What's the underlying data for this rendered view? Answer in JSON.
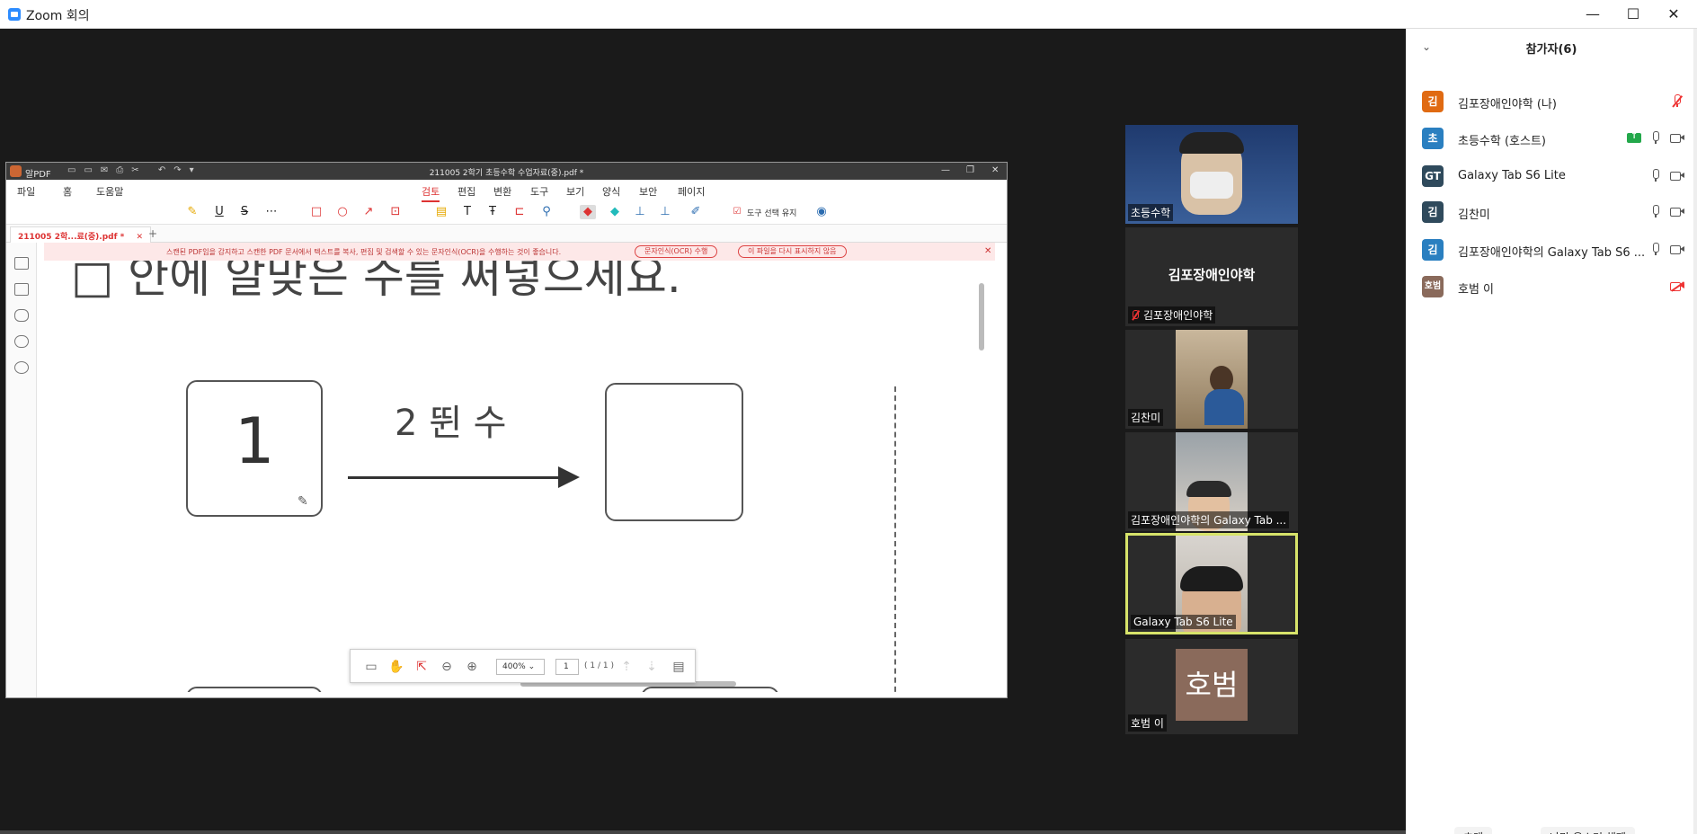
{
  "window": {
    "title": "Zoom 회의",
    "minimize": "—",
    "maximize": "☐",
    "close": "✕"
  },
  "pdf": {
    "app_name": "알PDF",
    "doc_title": "211005 2학기 초등수학 수업자료(중).pdf *",
    "menu": [
      "파일",
      "홈",
      "도움말"
    ],
    "ribbon_tabs": [
      "검토",
      "편집",
      "변환",
      "도구",
      "보기",
      "양식",
      "보안",
      "페이지"
    ],
    "active_tab": "검토",
    "keep_tool_label": "도구 선택 유지",
    "tab_label": "211005 2학...료(중).pdf *",
    "tab_close": "✕",
    "tab_add": "+",
    "ocr_message": "스캔된 PDF임을 감지하고 스캔한 PDF 문서에서 텍스트를 복사, 편집 및 검색할 수 있는 문자인식(OCR)을 수행하는 것이 좋습니다.",
    "ocr_button": "문자인식(OCR) 수행",
    "ocr_hide_button": "이 파일을 다시 표시하지 않음",
    "ocr_close": "✕",
    "page_content": {
      "instruction": "□ 안에 알맞은 수를 써넣으세요.",
      "start_number": "1",
      "arrow_label": "2 뛴 수"
    },
    "zoom": "400%",
    "page_input": "1",
    "page_count": "( 1 / 1 )"
  },
  "videos": [
    {
      "name": "초등수학",
      "type": "video"
    },
    {
      "name": "김포장애인야학",
      "type": "name-only",
      "center_label": "김포장애인야학",
      "muted": true
    },
    {
      "name": "김찬미",
      "type": "video"
    },
    {
      "name": "김포장애인야학의  Galaxy Tab ...",
      "type": "video"
    },
    {
      "name": "Galaxy Tab S6 Lite",
      "type": "video",
      "active": true
    },
    {
      "name": "호범 이",
      "type": "avatar",
      "avatar_text": "호범"
    }
  ],
  "participants": {
    "title": "참가자(6)",
    "collapse_icon": "⌄",
    "list": [
      {
        "avatar": "김",
        "color": "#e06a12",
        "name": "김포장애인야학 (나)",
        "mic": "off",
        "cam": "none"
      },
      {
        "avatar": "초",
        "color": "#2a7fc0",
        "name": "초등수학 (호스트)",
        "mic": "on",
        "cam": "on",
        "sharing": true
      },
      {
        "avatar": "GT",
        "color": "#2f4a5c",
        "name": "Galaxy Tab S6 Lite",
        "mic": "on",
        "cam": "on"
      },
      {
        "avatar": "김",
        "color": "#2f4a5c",
        "name": "김찬미",
        "mic": "on",
        "cam": "on"
      },
      {
        "avatar": "김",
        "color": "#2a7fc0",
        "name": "김포장애인야학의 Galaxy Tab S6 ...",
        "mic": "on",
        "cam": "on"
      },
      {
        "avatar": "호범",
        "color": "#8a6a5b",
        "name": "호범 이",
        "mic": "none",
        "cam": "off"
      }
    ],
    "invite_button": "초대",
    "unmute_me_button": "나만 음소거 해제"
  }
}
